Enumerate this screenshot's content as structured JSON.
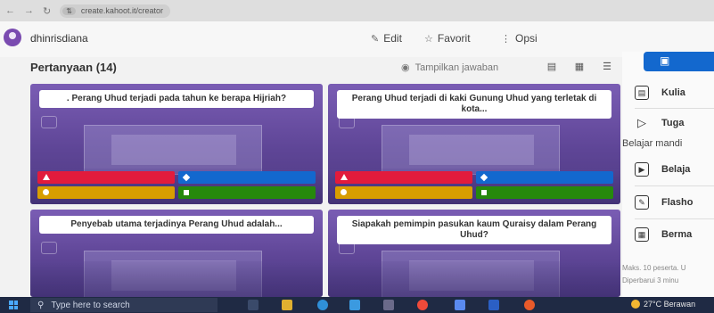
{
  "browser": {
    "url": "create.kahoot.it/creator",
    "back_icon": "arrow-left-icon",
    "forward_icon": "arrow-right-icon",
    "reload_icon": "reload-icon"
  },
  "header": {
    "username": "dhinrisdiana",
    "edit_label": "Edit",
    "favorite_label": "Favorit",
    "options_label": "Opsi"
  },
  "questions_section": {
    "title": "Pertanyaan (14)",
    "show_answers_label": "Tampilkan jawaban",
    "view_modes": [
      "list-view-icon",
      "grid-view-icon",
      "detail-view-icon"
    ]
  },
  "cards": [
    {
      "question": ". Perang Uhud terjadi pada tahun ke berapa Hijriah?"
    },
    {
      "question": "Perang Uhud terjadi di kaki Gunung Uhud yang terletak di kota..."
    },
    {
      "question": "Penyebab utama terjadinya Perang Uhud adalah..."
    },
    {
      "question": "Siapakah pemimpin pasukan kaum Quraisy dalam Perang Uhud?"
    }
  ],
  "answer_colors": {
    "red": "#e21b3c",
    "blue": "#1368ce",
    "yellow": "#d89e00",
    "green": "#26890c"
  },
  "right_panel": {
    "items_top": [
      {
        "label": "Kulia",
        "icon": "lecture-icon"
      },
      {
        "label": "Tuga",
        "icon": "assignment-icon"
      }
    ],
    "self_study_heading": "Belajar mandi",
    "items_bottom": [
      {
        "label": "Belaja",
        "icon": "play-icon"
      },
      {
        "label": "Flasho",
        "icon": "flashcard-icon"
      },
      {
        "label": "Berma",
        "icon": "game-grid-icon"
      }
    ],
    "note_1": "Maks. 10 peserta. U",
    "note_2": "Diperbarui 3 minu"
  },
  "taskbar": {
    "search_placeholder": "Type here to search",
    "weather": "27°C  Berawan"
  }
}
